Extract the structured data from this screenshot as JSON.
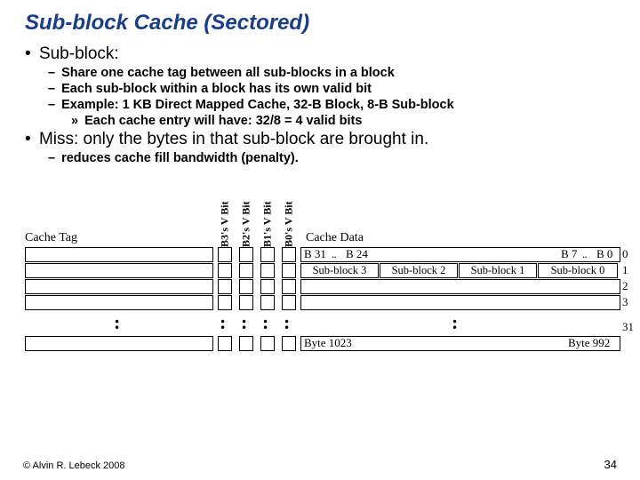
{
  "title": "Sub-block Cache (Sectored)",
  "bullets": {
    "b1a": "Sub-block:",
    "b2a": "Share one cache tag between all sub-blocks in a block",
    "b2b": "Each sub-block within a block has its own valid bit",
    "b2c": "Example: 1 KB Direct Mapped Cache, 32-B Block, 8-B Sub-block",
    "b3a": "Each cache entry will have: 32/8 = 4 valid bits",
    "b1b": "Miss: only the bytes in that sub-block are brought in.",
    "b2d": "reduces cache fill bandwidth (penalty)."
  },
  "diagram": {
    "cache_tag": "Cache Tag",
    "cache_data": "Cache Data",
    "vbits": [
      "SB3's V Bit",
      "SB2's V Bit",
      "SB1's V Bit",
      "SB0's V Bit"
    ],
    "byte_b31": "B 31",
    "byte_b24": "B 24",
    "byte_b7": "B 7",
    "byte_b0": "B 0",
    "sb3": "Sub-block 3",
    "sb2": "Sub-block 2",
    "sb1": "Sub-block 1",
    "sb0": "Sub-block 0",
    "rows": [
      "0",
      "1",
      "2",
      "3",
      "31"
    ],
    "byte_1023": "Byte 1023",
    "byte_992": "Byte 992",
    "dots": ":"
  },
  "footer": {
    "left": "© Alvin R. Lebeck 2008",
    "right": "34"
  }
}
